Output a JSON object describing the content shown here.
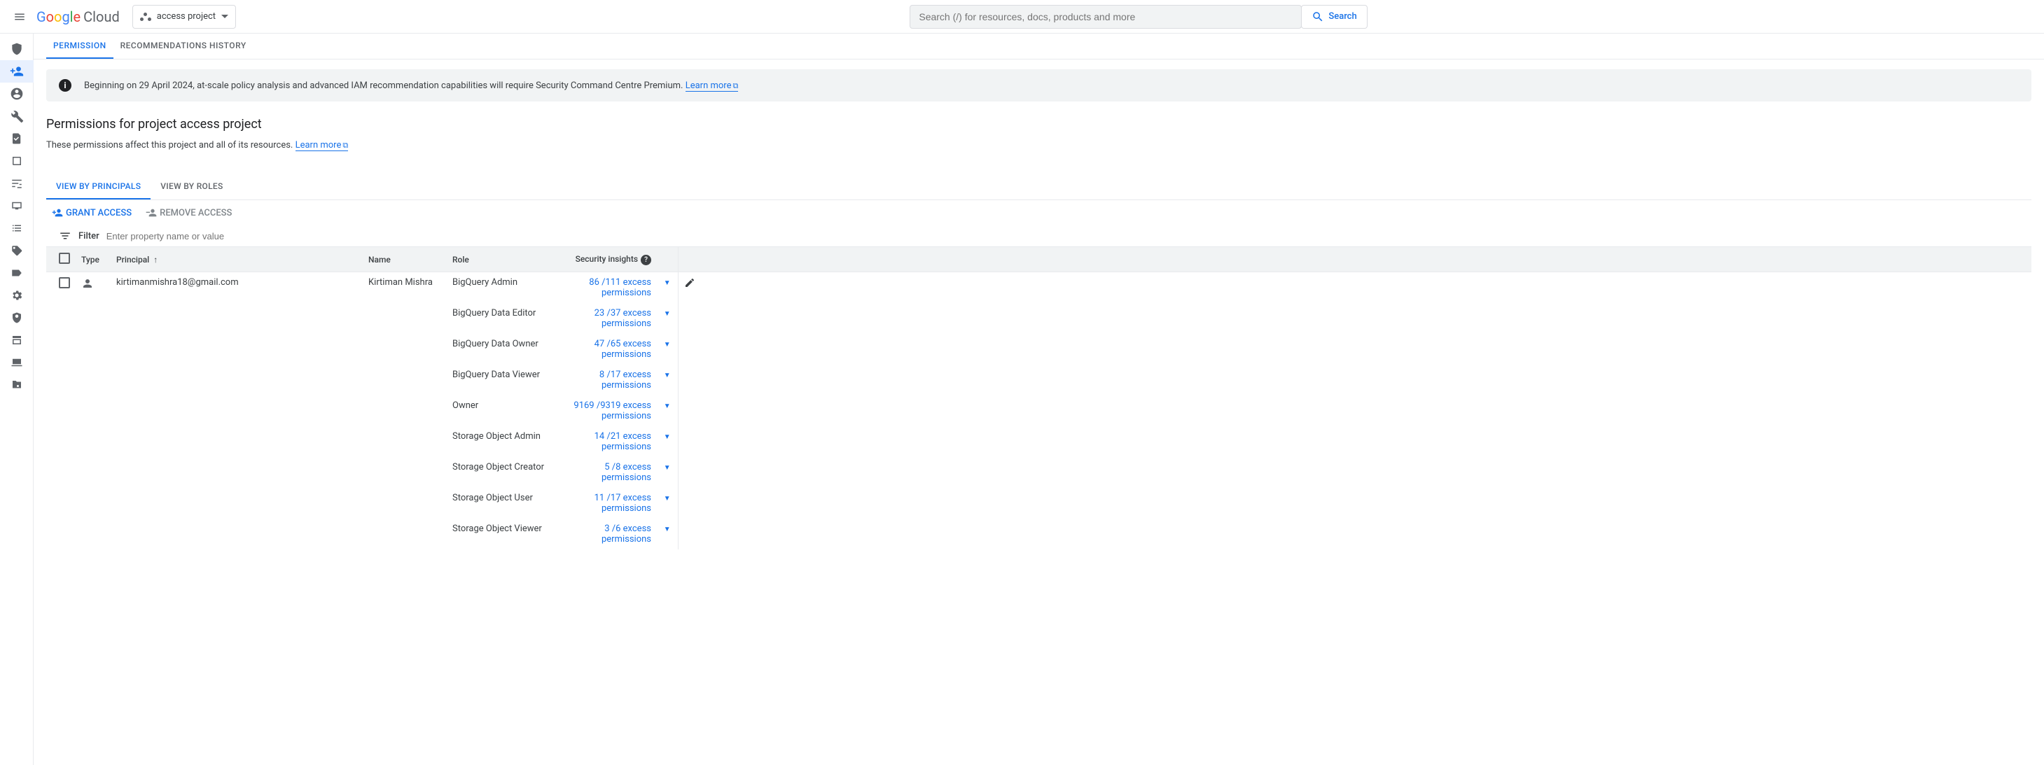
{
  "header": {
    "logo_text": "Google",
    "logo_suffix": "Cloud",
    "project_name": "access project",
    "search_placeholder": "Search (/) for resources, docs, products and more",
    "search_button": "Search"
  },
  "left_rail": {
    "items": [
      {
        "name": "security-shield-icon"
      },
      {
        "name": "iam-person-plus-icon",
        "active": true
      },
      {
        "name": "account-circle-icon"
      },
      {
        "name": "wrench-icon"
      },
      {
        "name": "document-check-icon"
      },
      {
        "name": "book-icon"
      },
      {
        "name": "controls-icon"
      },
      {
        "name": "screen-icon"
      },
      {
        "name": "list-icon"
      },
      {
        "name": "tag-icon"
      },
      {
        "name": "label-icon"
      },
      {
        "name": "gear-icon"
      },
      {
        "name": "privacy-shield-icon"
      },
      {
        "name": "form-icon"
      },
      {
        "name": "laptop-icon"
      },
      {
        "name": "folder-gear-icon"
      }
    ]
  },
  "tabs_top": {
    "items": [
      "PERMISSION",
      "RECOMMENDATIONS HISTORY"
    ],
    "active_index": 0
  },
  "banner": {
    "text": "Beginning on 29 April 2024, at-scale policy analysis and advanced IAM recommendation capabilities will require Security Command Centre Premium. ",
    "link": "Learn more"
  },
  "page": {
    "title": "Permissions for project access project",
    "desc": "These permissions affect this project and all of its resources. ",
    "desc_link": "Learn more"
  },
  "tabs_inner": {
    "items": [
      "VIEW BY PRINCIPALS",
      "VIEW BY ROLES"
    ],
    "active_index": 0
  },
  "actions": {
    "grant": "GRANT ACCESS",
    "remove": "REMOVE ACCESS"
  },
  "filter": {
    "label": "Filter",
    "placeholder": "Enter property name or value"
  },
  "table": {
    "headers": {
      "type": "Type",
      "principal": "Principal",
      "name": "Name",
      "role": "Role",
      "security": "Security insights"
    },
    "principal": {
      "email": "kirtimanmishra18@gmail.com",
      "display_name": "Kirtiman Mishra"
    },
    "roles": [
      {
        "role": "BigQuery Admin",
        "used": 86,
        "total": 111,
        "suffix": "excess permissions"
      },
      {
        "role": "BigQuery Data Editor",
        "used": 23,
        "total": 37,
        "suffix": "excess permissions"
      },
      {
        "role": "BigQuery Data Owner",
        "used": 47,
        "total": 65,
        "suffix": "excess permissions"
      },
      {
        "role": "BigQuery Data Viewer",
        "used": 8,
        "total": 17,
        "suffix": "excess permissions"
      },
      {
        "role": "Owner",
        "used": 9169,
        "total": 9319,
        "suffix": "excess permissions"
      },
      {
        "role": "Storage Object Admin",
        "used": 14,
        "total": 21,
        "suffix": "excess permissions"
      },
      {
        "role": "Storage Object Creator",
        "used": 5,
        "total": 8,
        "suffix": "excess permissions"
      },
      {
        "role": "Storage Object User",
        "used": 11,
        "total": 17,
        "suffix": "excess permissions"
      },
      {
        "role": "Storage Object Viewer",
        "used": 3,
        "total": 6,
        "suffix": "excess permissions"
      }
    ]
  }
}
